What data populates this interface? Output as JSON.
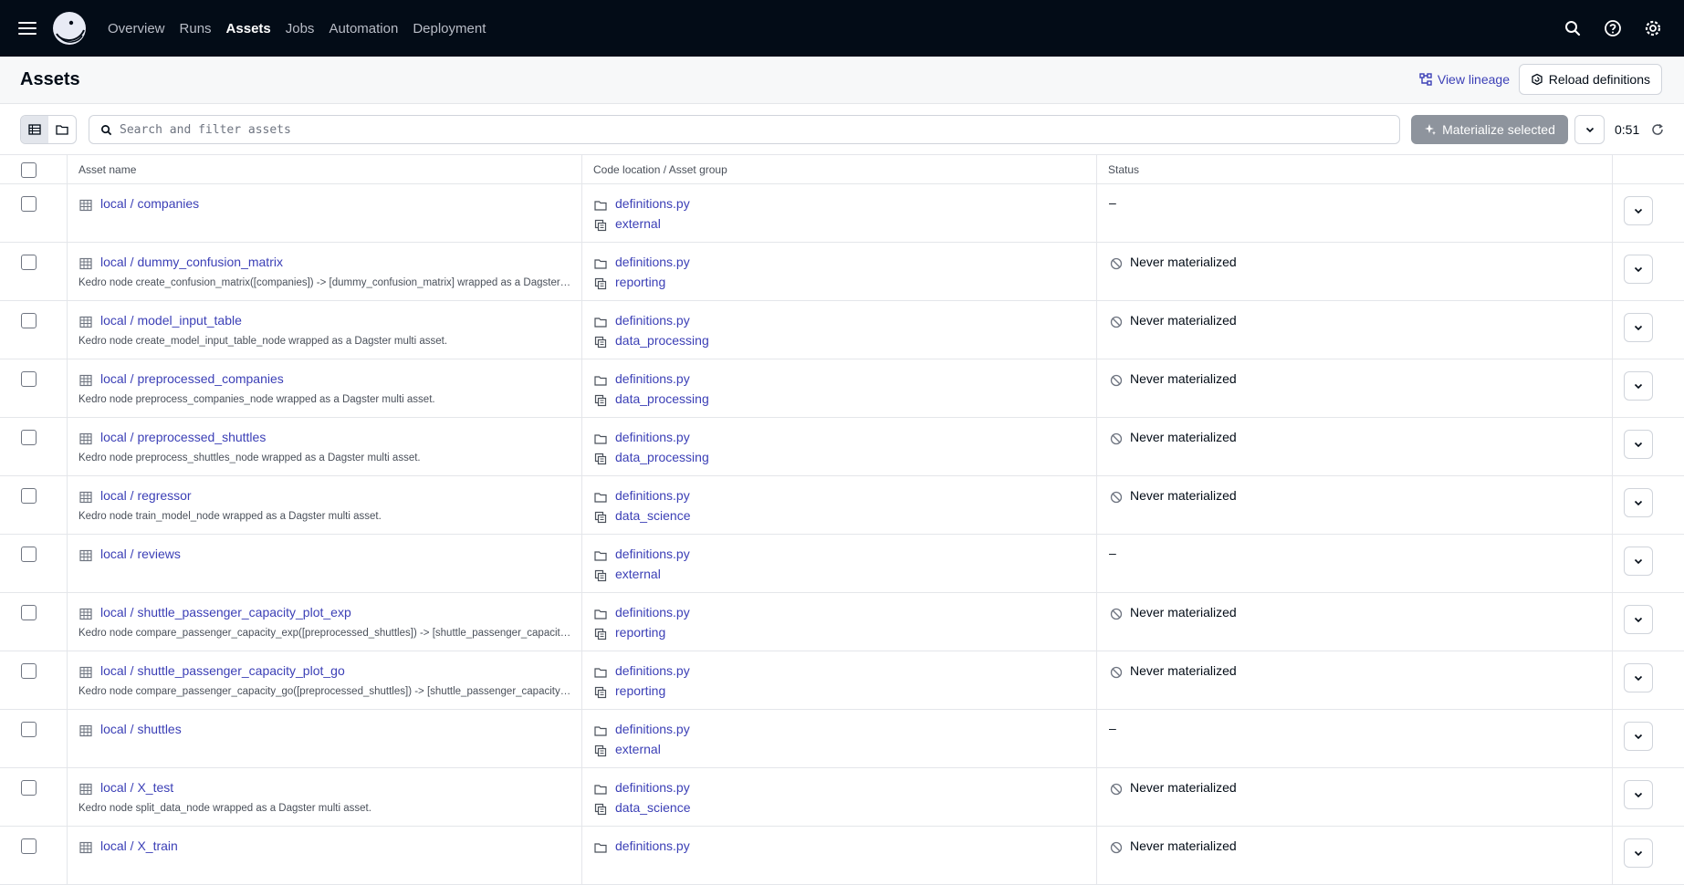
{
  "nav": {
    "links": [
      {
        "label": "Overview",
        "active": false
      },
      {
        "label": "Runs",
        "active": false
      },
      {
        "label": "Assets",
        "active": true
      },
      {
        "label": "Jobs",
        "active": false
      },
      {
        "label": "Automation",
        "active": false
      },
      {
        "label": "Deployment",
        "active": false
      }
    ]
  },
  "header": {
    "title": "Assets",
    "view_lineage": "View lineage",
    "reload": "Reload definitions"
  },
  "toolbar": {
    "search_placeholder": "Search and filter assets",
    "materialize": "Materialize selected",
    "timer": "0:51"
  },
  "table": {
    "columns": {
      "name": "Asset name",
      "location": "Code location / Asset group",
      "status": "Status"
    },
    "rows": [
      {
        "name": "local / companies",
        "desc": "",
        "location": "definitions.py",
        "group": "external",
        "status": "–",
        "materialized": false,
        "dash": true
      },
      {
        "name": "local / dummy_confusion_matrix",
        "desc": "Kedro node create_confusion_matrix([companies]) -> [dummy_confusion_matrix] wrapped as a Dagster multi asset.",
        "location": "definitions.py",
        "group": "reporting",
        "status": "Never materialized",
        "dash": false
      },
      {
        "name": "local / model_input_table",
        "desc": "Kedro node create_model_input_table_node wrapped as a Dagster multi asset.",
        "location": "definitions.py",
        "group": "data_processing",
        "status": "Never materialized",
        "dash": false
      },
      {
        "name": "local / preprocessed_companies",
        "desc": "Kedro node preprocess_companies_node wrapped as a Dagster multi asset.",
        "location": "definitions.py",
        "group": "data_processing",
        "status": "Never materialized",
        "dash": false
      },
      {
        "name": "local / preprocessed_shuttles",
        "desc": "Kedro node preprocess_shuttles_node wrapped as a Dagster multi asset.",
        "location": "definitions.py",
        "group": "data_processing",
        "status": "Never materialized",
        "dash": false
      },
      {
        "name": "local / regressor",
        "desc": "Kedro node train_model_node wrapped as a Dagster multi asset.",
        "location": "definitions.py",
        "group": "data_science",
        "status": "Never materialized",
        "dash": false
      },
      {
        "name": "local / reviews",
        "desc": "",
        "location": "definitions.py",
        "group": "external",
        "status": "–",
        "dash": true
      },
      {
        "name": "local / shuttle_passenger_capacity_plot_exp",
        "desc": "Kedro node compare_passenger_capacity_exp([preprocessed_shuttles]) -> [shuttle_passenger_capacity_plot_exp] wrapped as a Dagster multi asset.",
        "location": "definitions.py",
        "group": "reporting",
        "status": "Never materialized",
        "dash": false
      },
      {
        "name": "local / shuttle_passenger_capacity_plot_go",
        "desc": "Kedro node compare_passenger_capacity_go([preprocessed_shuttles]) -> [shuttle_passenger_capacity_plot_go] wrapped as a Dagster multi asset.",
        "location": "definitions.py",
        "group": "reporting",
        "status": "Never materialized",
        "dash": false
      },
      {
        "name": "local / shuttles",
        "desc": "",
        "location": "definitions.py",
        "group": "external",
        "status": "–",
        "dash": true
      },
      {
        "name": "local / X_test",
        "desc": "Kedro node split_data_node wrapped as a Dagster multi asset.",
        "location": "definitions.py",
        "group": "data_science",
        "status": "Never materialized",
        "dash": false
      },
      {
        "name": "local / X_train",
        "desc": "",
        "location": "definitions.py",
        "group": "",
        "status": "Never materialized",
        "dash": false
      }
    ]
  }
}
